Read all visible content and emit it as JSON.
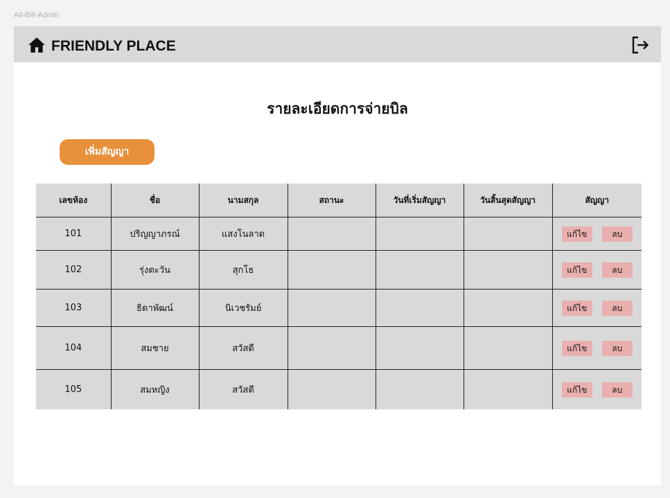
{
  "frame_label": "All-Bill-Admin",
  "header": {
    "brand": "FRIENDLY PLACE",
    "home_icon": "home-icon",
    "logout_icon": "logout-icon"
  },
  "page": {
    "title": "รายละเอียดการจ่ายบิล",
    "add_button_label": "เพิ่มสัญญา"
  },
  "table": {
    "columns": [
      "เลขห้อง",
      "ชื่อ",
      "นามสกุล",
      "สถานะ",
      "วันที่เริ่มสัญญา",
      "วันสิ้นสุดสัญญา",
      "สัญญา"
    ],
    "rows": [
      {
        "room": "101",
        "first_name": "ปริญญาภรณ์",
        "last_name": "แสงโนลาด",
        "status": "",
        "start": "",
        "end": "",
        "edit": "แก้ไข",
        "delete": "ลบ"
      },
      {
        "room": "102",
        "first_name": "รุ่งตะวัน",
        "last_name": "สุกโธ",
        "status": "",
        "start": "",
        "end": "",
        "edit": "แก้ไข",
        "delete": "ลบ"
      },
      {
        "room": "103",
        "first_name": "ธิดาพัฒน์",
        "last_name": "นิเวชรัมย์",
        "status": "",
        "start": "",
        "end": "",
        "edit": "แก้ไข",
        "delete": "ลบ"
      },
      {
        "room": "104",
        "first_name": "สมชาย",
        "last_name": "สวัสดี",
        "status": "",
        "start": "",
        "end": "",
        "edit": "แก้ไข",
        "delete": "ลบ"
      },
      {
        "room": "105",
        "first_name": "สมหญิง",
        "last_name": "สวัสดี",
        "status": "",
        "start": "",
        "end": "",
        "edit": "แก้ไข",
        "delete": "ลบ"
      }
    ]
  },
  "colors": {
    "header_bg": "#d9d9d9",
    "add_button": "#e8903a",
    "action_button": "#eab0b0",
    "table_bg": "#d9d9d9"
  }
}
